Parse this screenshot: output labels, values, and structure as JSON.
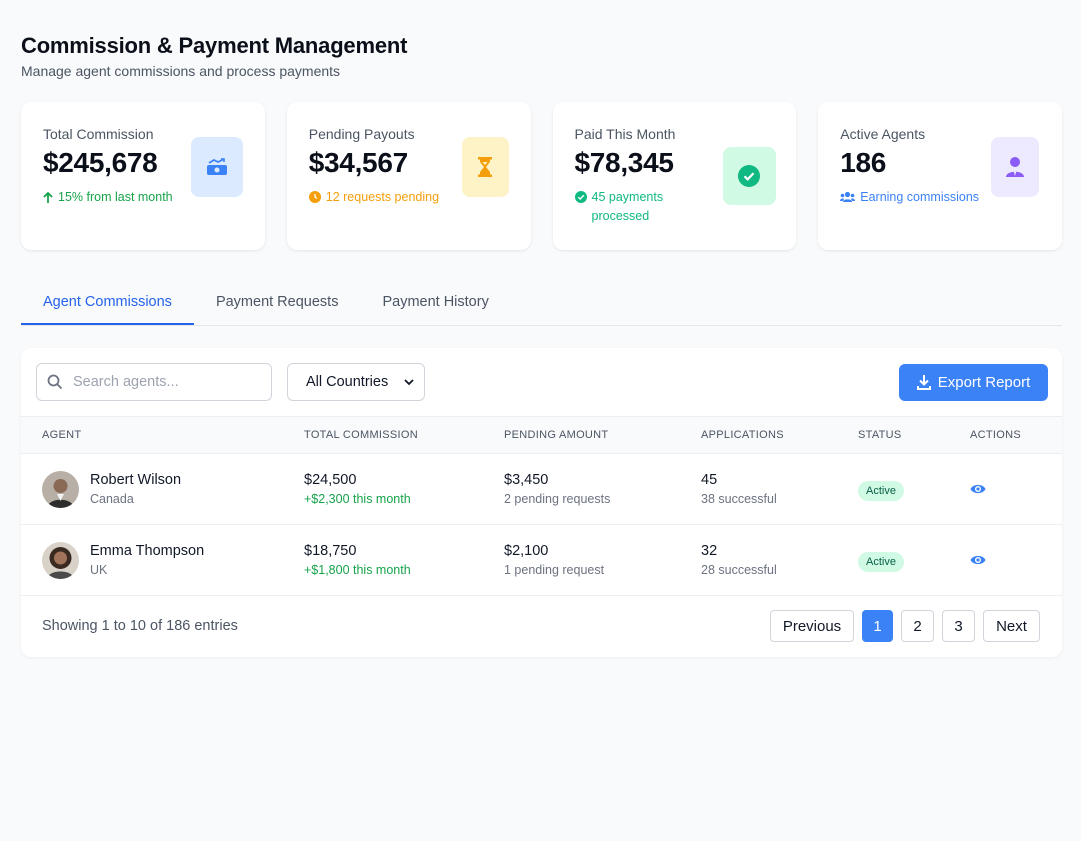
{
  "header": {
    "title": "Commission & Payment Management",
    "subtitle": "Manage agent commissions and process payments"
  },
  "stats": [
    {
      "label": "Total Commission",
      "value": "$245,678",
      "note": "15% from last month",
      "icon": "money-trend-icon",
      "color": "#3b82f6"
    },
    {
      "label": "Pending Payouts",
      "value": "$34,567",
      "note": "12 requests pending",
      "icon": "hourglass-icon",
      "color": "#f59e0b"
    },
    {
      "label": "Paid This Month",
      "value": "$78,345",
      "note": "45 payments processed",
      "icon": "check-circle-icon",
      "color": "#10b981"
    },
    {
      "label": "Active Agents",
      "value": "186",
      "note": "Earning commissions",
      "icon": "user-tie-icon",
      "color": "#8b5cf6"
    }
  ],
  "tabs": [
    "Agent Commissions",
    "Payment Requests",
    "Payment History"
  ],
  "toolbar": {
    "search_placeholder": "Search agents...",
    "country_filter": "All Countries",
    "export_label": "Export Report"
  },
  "table": {
    "columns": [
      "Agent",
      "Total Commission",
      "Pending Amount",
      "Applications",
      "Status",
      "Actions"
    ],
    "rows": [
      {
        "name": "Robert Wilson",
        "country": "Canada",
        "commission": "$24,500",
        "commission_delta": "+$2,300 this month",
        "pending": "$3,450",
        "pending_note": "2 pending requests",
        "applications": "45",
        "applications_note": "38 successful",
        "status": "Active"
      },
      {
        "name": "Emma Thompson",
        "country": "UK",
        "commission": "$18,750",
        "commission_delta": "+$1,800 this month",
        "pending": "$2,100",
        "pending_note": "1 pending request",
        "applications": "32",
        "applications_note": "28 successful",
        "status": "Active"
      }
    ]
  },
  "pagination": {
    "summary": "Showing 1 to 10 of 186 entries",
    "previous": "Previous",
    "pages": [
      "1",
      "2",
      "3"
    ],
    "current": "1",
    "next": "Next"
  },
  "colors": {
    "accent": "#3b82f6",
    "success": "#16a34a",
    "warning": "#f59e0b"
  }
}
